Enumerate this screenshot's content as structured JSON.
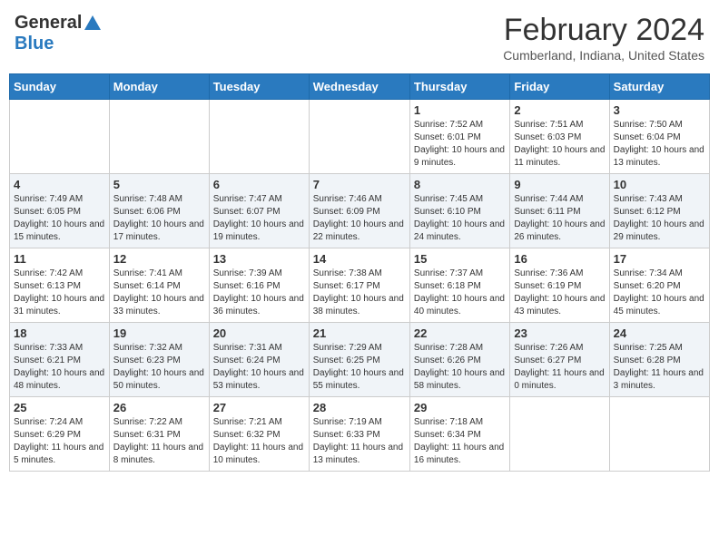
{
  "header": {
    "logo_general": "General",
    "logo_blue": "Blue",
    "title": "February 2024",
    "subtitle": "Cumberland, Indiana, United States"
  },
  "days_of_week": [
    "Sunday",
    "Monday",
    "Tuesday",
    "Wednesday",
    "Thursday",
    "Friday",
    "Saturday"
  ],
  "weeks": [
    [
      {
        "day": "",
        "info": ""
      },
      {
        "day": "",
        "info": ""
      },
      {
        "day": "",
        "info": ""
      },
      {
        "day": "",
        "info": ""
      },
      {
        "day": "1",
        "info": "Sunrise: 7:52 AM\nSunset: 6:01 PM\nDaylight: 10 hours and 9 minutes."
      },
      {
        "day": "2",
        "info": "Sunrise: 7:51 AM\nSunset: 6:03 PM\nDaylight: 10 hours and 11 minutes."
      },
      {
        "day": "3",
        "info": "Sunrise: 7:50 AM\nSunset: 6:04 PM\nDaylight: 10 hours and 13 minutes."
      }
    ],
    [
      {
        "day": "4",
        "info": "Sunrise: 7:49 AM\nSunset: 6:05 PM\nDaylight: 10 hours and 15 minutes."
      },
      {
        "day": "5",
        "info": "Sunrise: 7:48 AM\nSunset: 6:06 PM\nDaylight: 10 hours and 17 minutes."
      },
      {
        "day": "6",
        "info": "Sunrise: 7:47 AM\nSunset: 6:07 PM\nDaylight: 10 hours and 19 minutes."
      },
      {
        "day": "7",
        "info": "Sunrise: 7:46 AM\nSunset: 6:09 PM\nDaylight: 10 hours and 22 minutes."
      },
      {
        "day": "8",
        "info": "Sunrise: 7:45 AM\nSunset: 6:10 PM\nDaylight: 10 hours and 24 minutes."
      },
      {
        "day": "9",
        "info": "Sunrise: 7:44 AM\nSunset: 6:11 PM\nDaylight: 10 hours and 26 minutes."
      },
      {
        "day": "10",
        "info": "Sunrise: 7:43 AM\nSunset: 6:12 PM\nDaylight: 10 hours and 29 minutes."
      }
    ],
    [
      {
        "day": "11",
        "info": "Sunrise: 7:42 AM\nSunset: 6:13 PM\nDaylight: 10 hours and 31 minutes."
      },
      {
        "day": "12",
        "info": "Sunrise: 7:41 AM\nSunset: 6:14 PM\nDaylight: 10 hours and 33 minutes."
      },
      {
        "day": "13",
        "info": "Sunrise: 7:39 AM\nSunset: 6:16 PM\nDaylight: 10 hours and 36 minutes."
      },
      {
        "day": "14",
        "info": "Sunrise: 7:38 AM\nSunset: 6:17 PM\nDaylight: 10 hours and 38 minutes."
      },
      {
        "day": "15",
        "info": "Sunrise: 7:37 AM\nSunset: 6:18 PM\nDaylight: 10 hours and 40 minutes."
      },
      {
        "day": "16",
        "info": "Sunrise: 7:36 AM\nSunset: 6:19 PM\nDaylight: 10 hours and 43 minutes."
      },
      {
        "day": "17",
        "info": "Sunrise: 7:34 AM\nSunset: 6:20 PM\nDaylight: 10 hours and 45 minutes."
      }
    ],
    [
      {
        "day": "18",
        "info": "Sunrise: 7:33 AM\nSunset: 6:21 PM\nDaylight: 10 hours and 48 minutes."
      },
      {
        "day": "19",
        "info": "Sunrise: 7:32 AM\nSunset: 6:23 PM\nDaylight: 10 hours and 50 minutes."
      },
      {
        "day": "20",
        "info": "Sunrise: 7:31 AM\nSunset: 6:24 PM\nDaylight: 10 hours and 53 minutes."
      },
      {
        "day": "21",
        "info": "Sunrise: 7:29 AM\nSunset: 6:25 PM\nDaylight: 10 hours and 55 minutes."
      },
      {
        "day": "22",
        "info": "Sunrise: 7:28 AM\nSunset: 6:26 PM\nDaylight: 10 hours and 58 minutes."
      },
      {
        "day": "23",
        "info": "Sunrise: 7:26 AM\nSunset: 6:27 PM\nDaylight: 11 hours and 0 minutes."
      },
      {
        "day": "24",
        "info": "Sunrise: 7:25 AM\nSunset: 6:28 PM\nDaylight: 11 hours and 3 minutes."
      }
    ],
    [
      {
        "day": "25",
        "info": "Sunrise: 7:24 AM\nSunset: 6:29 PM\nDaylight: 11 hours and 5 minutes."
      },
      {
        "day": "26",
        "info": "Sunrise: 7:22 AM\nSunset: 6:31 PM\nDaylight: 11 hours and 8 minutes."
      },
      {
        "day": "27",
        "info": "Sunrise: 7:21 AM\nSunset: 6:32 PM\nDaylight: 11 hours and 10 minutes."
      },
      {
        "day": "28",
        "info": "Sunrise: 7:19 AM\nSunset: 6:33 PM\nDaylight: 11 hours and 13 minutes."
      },
      {
        "day": "29",
        "info": "Sunrise: 7:18 AM\nSunset: 6:34 PM\nDaylight: 11 hours and 16 minutes."
      },
      {
        "day": "",
        "info": ""
      },
      {
        "day": "",
        "info": ""
      }
    ]
  ]
}
